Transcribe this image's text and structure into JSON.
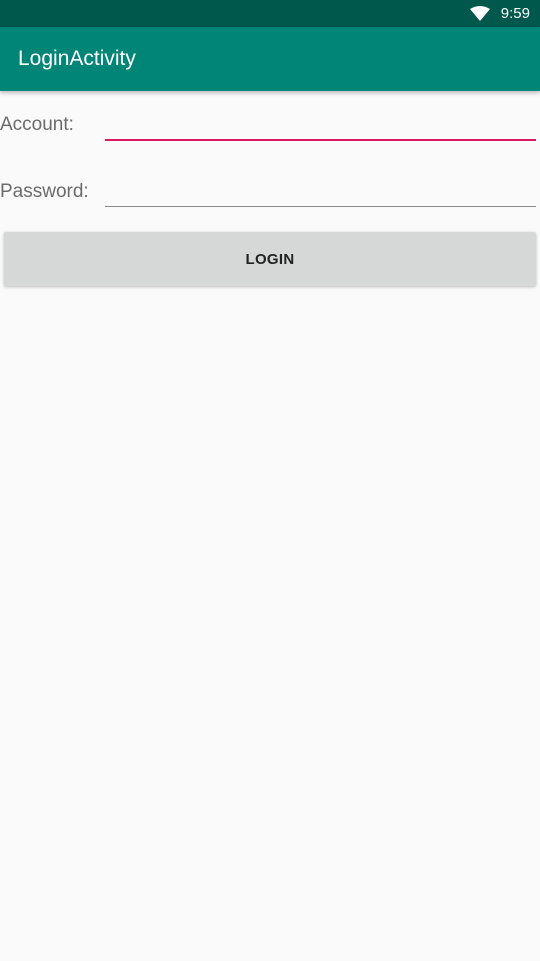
{
  "status_bar": {
    "time": "9:59",
    "icons": [
      "wifi-icon"
    ],
    "color": "#00574b"
  },
  "app_bar": {
    "title": "LoginActivity",
    "color": "#008577"
  },
  "form": {
    "account": {
      "label": "Account:",
      "value": "",
      "focused": true,
      "accent_color": "#d81b60"
    },
    "password": {
      "label": "Password:",
      "value": ""
    },
    "login_button": {
      "label": "LOGIN"
    }
  }
}
